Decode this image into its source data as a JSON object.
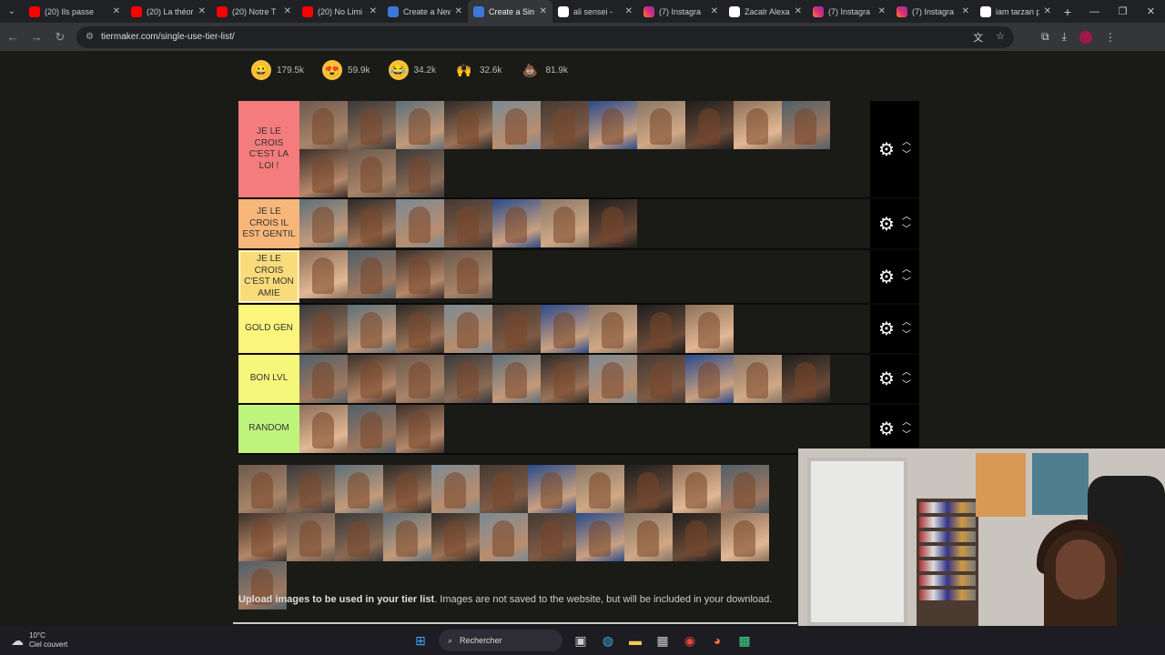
{
  "browser": {
    "tabs": [
      {
        "title": "(20) Ils passe",
        "icon": "youtube-icon",
        "fav": "yt",
        "width": 112
      },
      {
        "title": "(20) La théor",
        "icon": "youtube-icon",
        "fav": "yt",
        "width": 94
      },
      {
        "title": "(20) Notre T",
        "icon": "youtube-icon",
        "fav": "yt",
        "width": 94
      },
      {
        "title": "(20) No Limi",
        "icon": "youtube-icon",
        "fav": "yt",
        "width": 94
      },
      {
        "title": "Create a New",
        "icon": "document-icon",
        "fav": "doc",
        "width": 94
      },
      {
        "title": "Create a Sin",
        "icon": "document-icon",
        "fav": "doc",
        "width": 93,
        "active": true
      },
      {
        "title": "ali sensei -",
        "icon": "google-icon",
        "fav": "g",
        "width": 94
      },
      {
        "title": "(7) Instagra",
        "icon": "instagram-icon",
        "fav": "ig",
        "width": 94
      },
      {
        "title": "Zacalr Alexa",
        "icon": "globe-icon",
        "fav": "g",
        "width": 92
      },
      {
        "title": "(7) Instagra",
        "icon": "instagram-icon",
        "fav": "ig",
        "width": 92
      },
      {
        "title": "(7) Instagra",
        "icon": "instagram-icon",
        "fav": "ig",
        "width": 92
      },
      {
        "title": "iam tarzan p",
        "icon": "google-icon",
        "fav": "g",
        "width": 90
      }
    ],
    "url": "tiermaker.com/single-use-tier-list/"
  },
  "reactions": [
    {
      "emoji": "😀",
      "count": "179.5k",
      "bg": "#f7c23a"
    },
    {
      "emoji": "😍",
      "count": "59.9k",
      "bg": "#f7c23a"
    },
    {
      "emoji": "😂",
      "count": "34.2k",
      "bg": "#f7c23a"
    },
    {
      "emoji": "🙌",
      "count": "32.6k",
      "bg": "#1a1a17"
    },
    {
      "emoji": "💩",
      "count": "81.9k",
      "bg": "#1a1a17"
    }
  ],
  "tiers": [
    {
      "label": "JE LE CROIS C'EST LA LOI !",
      "color": "#f47c7c",
      "count": 14,
      "height": 106
    },
    {
      "label": "JE LE CROIS IL EST GENTIL",
      "color": "#f7b77a",
      "count": 7,
      "height": 56
    },
    {
      "label": "JE LE CROIS C'EST MON AMIE",
      "color": "#f9db7a",
      "count": 4,
      "height": 56,
      "selected": true
    },
    {
      "label": "GOLD GEN",
      "color": "#fbf57c",
      "count": 9,
      "height": 53
    },
    {
      "label": "BON LVL",
      "color": "#f5f77a",
      "count": 11,
      "height": 53
    },
    {
      "label": "RANDOM",
      "color": "#bff47c",
      "count": 3,
      "height": 53
    }
  ],
  "pool_count": 23,
  "upload": {
    "bold": "Upload images to be used in your tier list",
    "rest": ". Images are not saved to the website, but will be included in your download."
  },
  "taskbar": {
    "temp": "10°C",
    "condition": "Ciel couvert",
    "search_placeholder": "Rechercher"
  }
}
